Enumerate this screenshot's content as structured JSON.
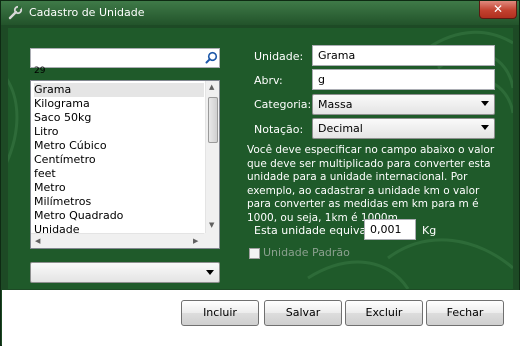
{
  "window": {
    "title": "Cadastro de Unidade",
    "close_glyph": "✕"
  },
  "colors": {
    "panel_green": "#1f5a2a",
    "titlebar_green": "#2f6b38",
    "close_red": "#c2412f"
  },
  "left": {
    "search": {
      "value": "",
      "icon": "search-icon"
    },
    "count": "29",
    "list_items": [
      "Grama",
      "Kilograma",
      "Saco 50kg",
      "Litro",
      "Metro Cúbico",
      "Centímetro",
      "feet",
      "Metro",
      "Milímetros",
      "Metro Quadrado",
      "Unidade"
    ],
    "selected_index": 0,
    "filter_combo": {
      "value": ""
    }
  },
  "form": {
    "unidade_label": "Unidade:",
    "unidade_value": "Grama",
    "abrv_label": "Abrv:",
    "abrv_value": "g",
    "categoria_label": "Categoria:",
    "categoria_value": "Massa",
    "notacao_label": "Notação:",
    "notacao_value": "Decimal",
    "info": "Você deve especificar no campo abaixo o valor que deve ser multiplicado para converter esta unidade para a unidade internacional. Por exemplo, ao cadastrar a unidade km o valor para converter as medidas em km para m é 1000, ou seja, 1km é 1000m.",
    "equivale_label": "Esta unidade equivale a",
    "equivale_value": "0,001",
    "equivale_unit": "Kg",
    "padrao_label": "Unidade Padrão",
    "padrao_checked": false
  },
  "buttons": {
    "incluir": "Incluir",
    "salvar": "Salvar",
    "excluir": "Excluir",
    "fechar": "Fechar"
  }
}
